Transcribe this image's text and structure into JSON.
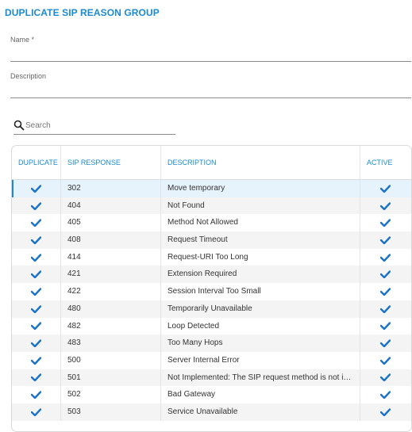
{
  "title": "DUPLICATE SIP REASON GROUP",
  "form": {
    "name_label": "Name *",
    "description_label": "Description"
  },
  "search": {
    "placeholder": "Search",
    "value": ""
  },
  "table": {
    "columns": [
      "DUPLICATE",
      "SIP RESPONSE",
      "DESCRIPTION",
      "ACTIVE"
    ],
    "rows": [
      {
        "duplicate": true,
        "code": "302",
        "description": "Move temporary",
        "active": true,
        "selected": true
      },
      {
        "duplicate": true,
        "code": "404",
        "description": "Not Found",
        "active": true
      },
      {
        "duplicate": true,
        "code": "405",
        "description": "Method Not Allowed",
        "active": true
      },
      {
        "duplicate": true,
        "code": "408",
        "description": "Request Timeout",
        "active": true
      },
      {
        "duplicate": true,
        "code": "414",
        "description": "Request-URI Too Long",
        "active": true
      },
      {
        "duplicate": true,
        "code": "421",
        "description": "Extension Required",
        "active": true
      },
      {
        "duplicate": true,
        "code": "422",
        "description": "Session Interval Too Small",
        "active": true
      },
      {
        "duplicate": true,
        "code": "480",
        "description": "Temporarily Unavailable",
        "active": true
      },
      {
        "duplicate": true,
        "code": "482",
        "description": "Loop Detected",
        "active": true
      },
      {
        "duplicate": true,
        "code": "483",
        "description": "Too Many Hops",
        "active": true
      },
      {
        "duplicate": true,
        "code": "500",
        "description": "Server Internal Error",
        "active": true
      },
      {
        "duplicate": true,
        "code": "501",
        "description": "Not Implemented: The SIP request method is not implemented here",
        "active": true
      },
      {
        "duplicate": true,
        "code": "502",
        "description": "Bad Gateway",
        "active": true
      },
      {
        "duplicate": true,
        "code": "503",
        "description": "Service Unavailable",
        "active": true
      }
    ]
  },
  "icons": {
    "search": "search-icon",
    "check": "check-icon"
  },
  "colors": {
    "accent": "#1a8ad2",
    "check": "#1a73c7",
    "row_alt": "#f4f4f4",
    "row_selected": "#e6f2fc"
  }
}
